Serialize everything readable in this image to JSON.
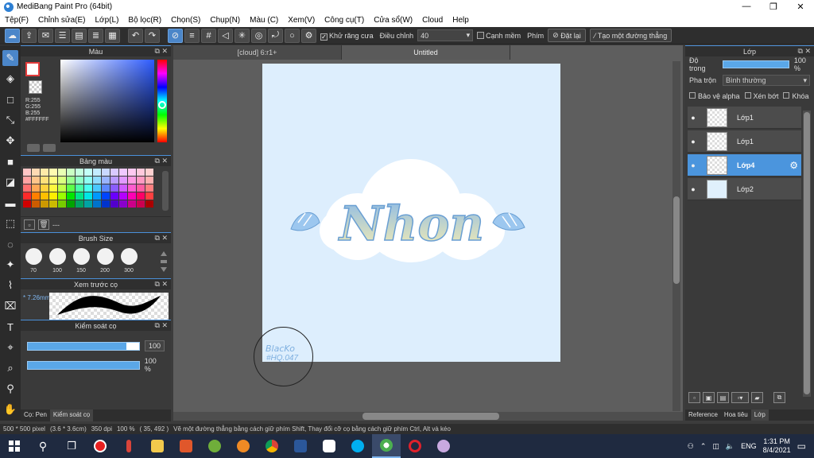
{
  "window": {
    "title": "MediBang Paint Pro (64bit)",
    "controls": [
      "—",
      "❐",
      "✕"
    ]
  },
  "menu": [
    "Tệp(F)",
    "Chỉnh sửa(E)",
    "Lớp(L)",
    "Bộ lọc(R)",
    "Chọn(S)",
    "Chụp(N)",
    "Màu (C)",
    "Xem(V)",
    "Công cụ(T)",
    "Cửa sổ(W)",
    "Cloud",
    "Help"
  ],
  "toolbar": {
    "antialias_label": "Khử răng cưa",
    "adjust_label": "Điều chỉnh",
    "adjust_value": "40",
    "snap_label": "Cạnh mềm",
    "phim_label": "Phím",
    "reset_label": "Đặt lại",
    "line_label": "Tạo một đường thẳng"
  },
  "color_panel": {
    "title": "Màu",
    "rgb_text": "R:255\nG:255\nB:255\n#FFFFFF"
  },
  "palette_panel": {
    "title": "Bảng màu",
    "extra": "---",
    "colors": [
      "#ffc6c6",
      "#ffd9b3",
      "#ffeaa8",
      "#fffbb0",
      "#e9ffb3",
      "#c9ffc3",
      "#c3ffe0",
      "#c3fff7",
      "#c3ecff",
      "#c9d8ff",
      "#d9c9ff",
      "#f0c9ff",
      "#ffc9f0",
      "#ffc9dc",
      "#ffd0d0",
      "#ffa3a3",
      "#ffc48a",
      "#ffe07a",
      "#fff97a",
      "#d9ff80",
      "#99ff8f",
      "#8fffc8",
      "#8ffff2",
      "#8fdcff",
      "#99b3ff",
      "#b899ff",
      "#e199ff",
      "#ff99e1",
      "#ff99c2",
      "#ffb0b0",
      "#ff7070",
      "#ffa857",
      "#ffd23f",
      "#fff63f",
      "#c2ff4a",
      "#5cff4a",
      "#4affa8",
      "#4afff0",
      "#4ac8ff",
      "#5c87ff",
      "#8a5cff",
      "#cf5cff",
      "#ff5ccf",
      "#ff5ca1",
      "#ff8080",
      "#ff2a2a",
      "#ff7f00",
      "#ffbf00",
      "#ffee00",
      "#99ff00",
      "#00e600",
      "#00e68a",
      "#00e6e6",
      "#0099ff",
      "#0044ff",
      "#6a00ff",
      "#b300ff",
      "#ff00b3",
      "#ff0066",
      "#ff4040",
      "#d00000",
      "#cc5c00",
      "#cc9900",
      "#ccbb00",
      "#77cc00",
      "#00a300",
      "#00a363",
      "#00a3a3",
      "#0073cc",
      "#0033cc",
      "#5200cc",
      "#8a00cc",
      "#cc008a",
      "#cc0050",
      "#aa0000"
    ]
  },
  "brush_size_panel": {
    "title": "Brush Size",
    "sizes": [
      "70",
      "100",
      "150",
      "200",
      "300"
    ]
  },
  "preview_panel": {
    "title": "Xem trước cọ",
    "size_text": "7.26mm"
  },
  "brush_control_panel": {
    "title": "Kiểm soát cọ",
    "size_value": "100",
    "opacity_value": "100 %"
  },
  "left_tabs": [
    "Cọ: Pen",
    "Kiểm soát cọ"
  ],
  "document_tabs": [
    "[cloud] 6:r1+",
    "Untitled"
  ],
  "artwork": {
    "title_text": "Nhon",
    "signature_line1": "BlacKo",
    "signature_line2": "#HQ.047"
  },
  "layers_panel": {
    "title": "Lớp",
    "opacity_label": "Độ trong",
    "opacity_value": "100 %",
    "blend_label": "Pha trộn",
    "blend_value": "Bình thường",
    "protect_alpha": "Bảo vệ alpha",
    "clip": "Xén bớt",
    "lock": "Khóa",
    "layers": [
      {
        "name": "Lớp1",
        "selected": false
      },
      {
        "name": "Lớp1",
        "selected": false
      },
      {
        "name": "Lớp4",
        "selected": true
      },
      {
        "name": "Lớp2",
        "selected": false
      }
    ],
    "tabs": [
      "Reference",
      "Hoa tiêu",
      "Lớp"
    ]
  },
  "status": {
    "pixels": "500 * 500 pixel",
    "cm": "(3.6 * 3.6cm)",
    "dpi": "350 dpi",
    "zoom": "100 %",
    "coords": "( 35, 492 )",
    "hint": "Vẽ một đường thẳng bằng cách giữ phím Shift, Thay đổi cỡ cọ bằng cách giữ phím Ctrl, Alt và kéo"
  },
  "taskbar": {
    "lang": "ENG",
    "time": "1:31 PM",
    "date": "8/4/2021"
  }
}
